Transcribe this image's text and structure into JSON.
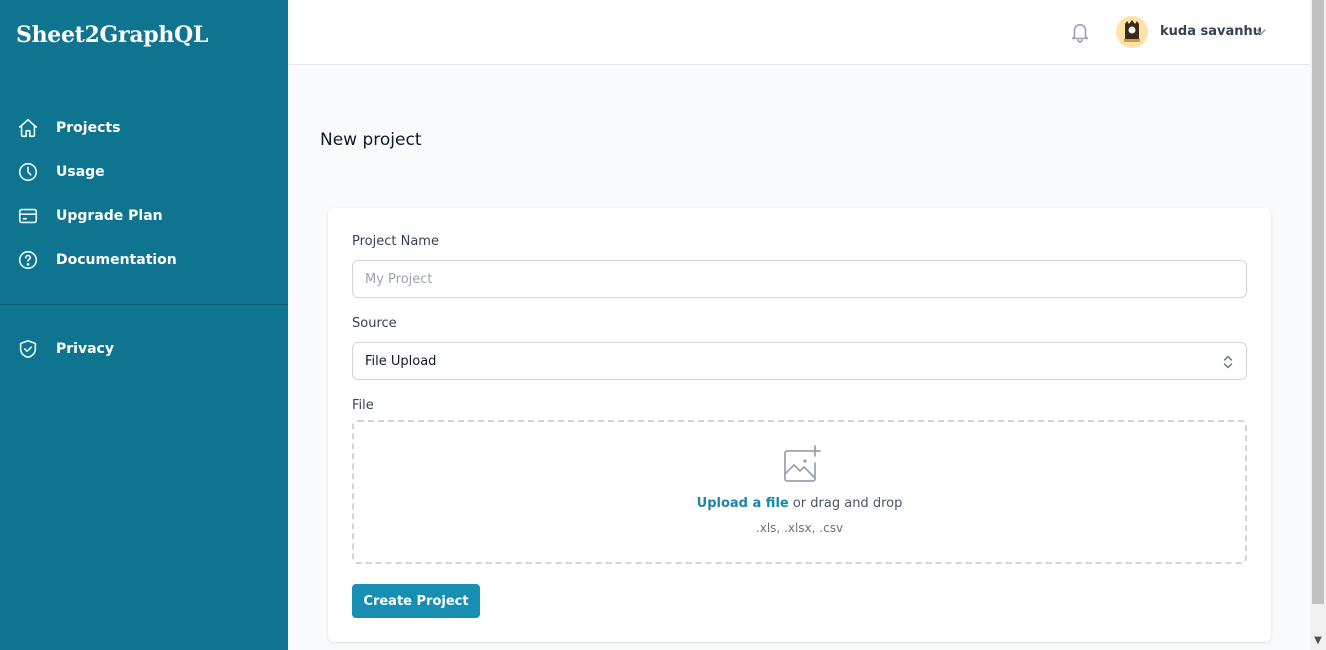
{
  "brand": {
    "name": "Sheet2GraphQL"
  },
  "sidebar": {
    "items": [
      {
        "label": "Projects",
        "icon": "home-icon"
      },
      {
        "label": "Usage",
        "icon": "clock-icon"
      },
      {
        "label": "Upgrade Plan",
        "icon": "credit-card-icon"
      },
      {
        "label": "Documentation",
        "icon": "question-circle-icon"
      }
    ],
    "secondary_items": [
      {
        "label": "Privacy",
        "icon": "shield-check-icon"
      }
    ]
  },
  "header": {
    "user_name": "kuda savanhu",
    "notification_icon": "bell-icon",
    "menu_icon": "chevron-down-icon"
  },
  "main": {
    "title": "New project",
    "form": {
      "project_name": {
        "label": "Project Name",
        "placeholder": "My Project",
        "value": ""
      },
      "source": {
        "label": "Source",
        "value": "File Upload"
      },
      "file": {
        "label": "File",
        "upload_link": "Upload a file",
        "upload_text": " or drag and drop",
        "hint": ".xls, .xlsx, .csv"
      },
      "submit_label": "Create Project"
    }
  },
  "colors": {
    "sidebar_bg": "#0f7490",
    "accent": "#168fb2",
    "link": "#1a86a8"
  }
}
